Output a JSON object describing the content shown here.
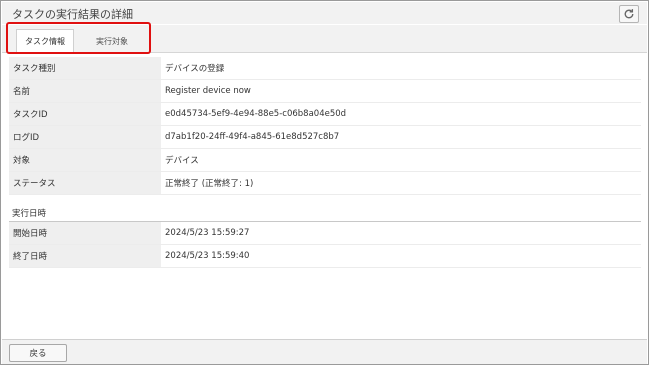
{
  "window": {
    "title": "タスクの実行結果の詳細"
  },
  "toolbar": {
    "refresh_icon": "refresh-icon"
  },
  "tabs": [
    {
      "label": "タスク情報",
      "active": true
    },
    {
      "label": "実行対象",
      "active": false
    }
  ],
  "task_info": {
    "rows": [
      {
        "label": "タスク種別",
        "value": "デバイスの登録"
      },
      {
        "label": "名前",
        "value": "Register device now"
      },
      {
        "label": "タスクID",
        "value": "e0d45734-5ef9-4e94-88e5-c06b8a04e50d"
      },
      {
        "label": "ログID",
        "value": "d7ab1f20-24ff-49f4-a845-61e8d527c8b7"
      },
      {
        "label": "対象",
        "value": "デバイス"
      },
      {
        "label": "ステータス",
        "value": "正常終了 (正常終了: 1)"
      }
    ]
  },
  "execution": {
    "heading": "実行日時",
    "rows": [
      {
        "label": "開始日時",
        "value": "2024/5/23 15:59:27"
      },
      {
        "label": "終了日時",
        "value": "2024/5/23 15:59:40"
      }
    ]
  },
  "footer": {
    "back_label": "戻る"
  },
  "colors": {
    "highlight": "#e01010",
    "label_bg": "#efefef",
    "bar_bg": "#f2f2f2"
  }
}
